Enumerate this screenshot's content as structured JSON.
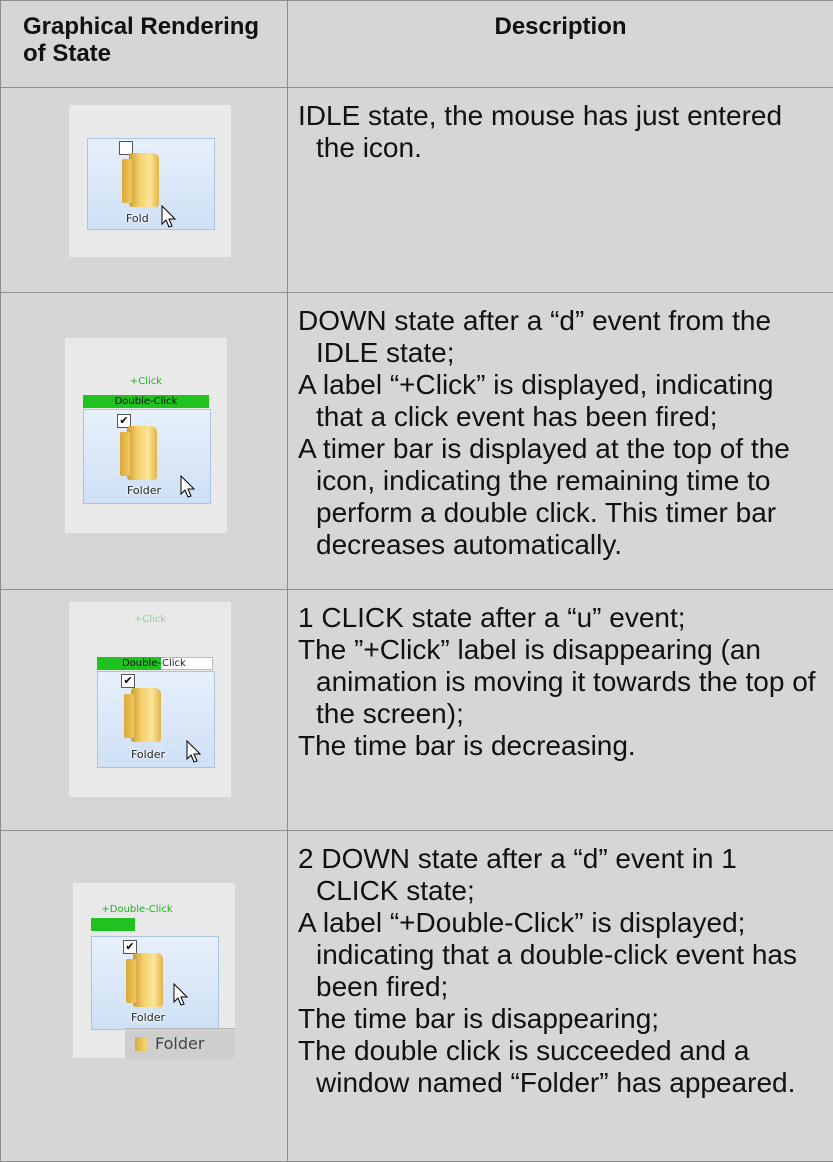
{
  "header": {
    "col1": "Graphical Rendering of State",
    "col2": "Description"
  },
  "rows": [
    {
      "graphic": {
        "label": "Fold",
        "checkbox": "",
        "green_label": "",
        "timer_text": "",
        "timer_fill": 0
      },
      "lines": [
        "IDLE state, the mouse has just entered the icon."
      ]
    },
    {
      "graphic": {
        "label": "Folder",
        "checkbox": "✔",
        "green_label": "+Click",
        "timer_text": "Double-Click",
        "timer_fill": 1.0
      },
      "lines": [
        "DOWN state after a “d” event from the IDLE state;",
        "A label “+Click” is displayed, indicating that a click event has been fired;",
        "A timer bar is displayed at the top of the icon, indicating the remaining time to perform a double click. This timer bar decreases automatically."
      ]
    },
    {
      "graphic": {
        "label": "Folder",
        "checkbox": "✔",
        "green_label": "+Click",
        "timer_text_filled": "Double-",
        "timer_text_rest": "Click",
        "timer_fill": 0.55
      },
      "lines": [
        "1 CLICK state after a “u” event;",
        "The ”+Click” label is disappearing (an animation is moving it towards the top of the screen);",
        "The time bar is decreasing."
      ]
    },
    {
      "graphic": {
        "label": "Folder",
        "checkbox": "✔",
        "green_label": "+Double-Click",
        "timer_fill": 0.35,
        "window_label": "Folder"
      },
      "lines": [
        "2 DOWN state after a “d” event in 1 CLICK state;",
        "A label “+Double-Click” is displayed; indicating that a double-click event has been fired;",
        "The time bar is disappearing;",
        "The double click is succeeded and a window named “Folder” has appeared."
      ]
    }
  ],
  "colors": {
    "cell_bg": "#d6d6d6",
    "border": "#8e8e8e",
    "green": "#1fc21f"
  }
}
